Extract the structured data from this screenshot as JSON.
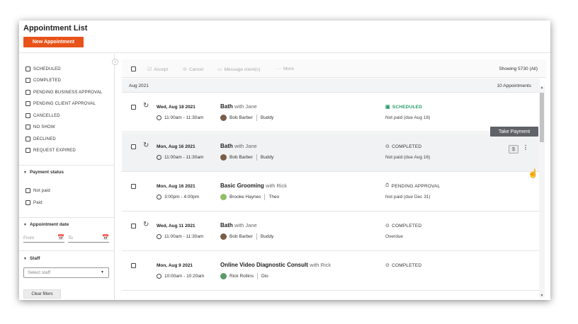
{
  "header": {
    "title": "Appointment List",
    "new_button": "New Appointment"
  },
  "filters": {
    "statuses": [
      "SCHEDULED",
      "COMPLETED",
      "PENDING BUSINESS APPROVAL",
      "PENDING CLIENT APPROVAL",
      "CANCELLED",
      "NO SHOW",
      "DECLINED",
      "REQUEST EXPIRED"
    ],
    "payment_status": {
      "heading": "Payment status",
      "options": [
        "Not paid",
        "Paid"
      ]
    },
    "appointment_date": {
      "heading": "Appointment date",
      "from_placeholder": "From",
      "to_placeholder": "To"
    },
    "staff": {
      "heading": "Staff",
      "placeholder": "Select staff"
    },
    "clear_button": "Clear filters"
  },
  "toolbar": {
    "accept": "Accept",
    "cancel": "Cancel",
    "message": "Message client(s)",
    "more": "More",
    "showing": "Showing 5730 (All)"
  },
  "group": {
    "label": "Aug 2021",
    "count": "10 Appointments"
  },
  "tooltip": "Take Payment",
  "appointments": [
    {
      "date": "Wed, Aug 18 2021",
      "time": "11:00am - 11:30am",
      "service": "Bath",
      "with": "with Jane",
      "client": "Bob Barber",
      "pet": "Buddy",
      "status": "SCHEDULED",
      "payment": "Not paid (due Aug 18)"
    },
    {
      "date": "Mon, Aug 16 2021",
      "time": "11:00am - 11:30am",
      "service": "Bath",
      "with": "with Jane",
      "client": "Bob Barber",
      "pet": "Buddy",
      "status": "COMPLETED",
      "payment": "Not paid (due Aug 16)"
    },
    {
      "date": "Mon, Aug 16 2021",
      "time": "3:00pm - 4:00pm",
      "service": "Basic Grooming",
      "with": "with Rick",
      "client": "Brooke Haynes",
      "pet": "Theo",
      "status": "PENDING APPROVAL",
      "payment": "Not paid (due Dec 31)"
    },
    {
      "date": "Wed, Aug 11 2021",
      "time": "11:00am - 11:30am",
      "service": "Bath",
      "with": "with Jane",
      "client": "Bob Barber",
      "pet": "Buddy",
      "status": "COMPLETED",
      "payment": "Overdue"
    },
    {
      "date": "Mon, Aug 9 2021",
      "time": "10:00am - 10:20am",
      "service": "Online Video Diagnostic Consult",
      "with": "with Rick",
      "client": "Rick Rollins",
      "pet": "Dio",
      "status": "COMPLETED",
      "payment": ""
    }
  ],
  "colors": {
    "brand": "#e8531a",
    "scheduled": "#2a9d6d",
    "tooltip": "#5f6368"
  }
}
